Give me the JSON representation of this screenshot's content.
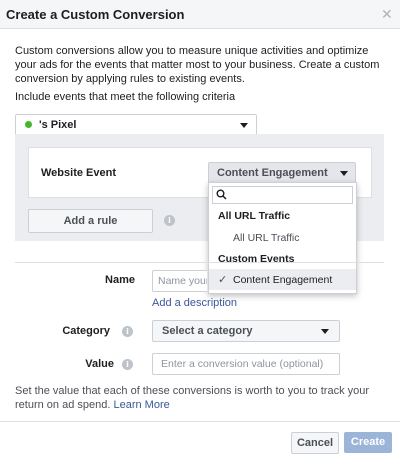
{
  "dialog": {
    "title": "Create a Custom Conversion",
    "close_icon": "close-icon"
  },
  "intro": {
    "text": "Custom conversions allow you to measure unique activities and optimize your ads for the events that matter most to your business. Create a custom conversion by applying rules to existing events.",
    "criteria_label": "Include events that meet the following criteria"
  },
  "pixel": {
    "label": "'s Pixel",
    "status_color": "#42b72a"
  },
  "rule": {
    "event_label": "Website Event",
    "event_selected": "Content Engagement",
    "add_rule_label": "Add a rule"
  },
  "event_menu": {
    "search_icon": "search-icon",
    "group1_header": "All URL Traffic",
    "group1_item": "All URL Traffic",
    "group2_header": "Custom Events",
    "group2_item": "Content Engagement",
    "checked_icon": "check-icon"
  },
  "form": {
    "name_label": "Name",
    "name_placeholder": "Name your c",
    "add_description": "Add a description",
    "category_label": "Category",
    "category_value": "Select a category",
    "value_label": "Value",
    "value_placeholder": "Enter a conversion value (optional)"
  },
  "helper": {
    "text": "Set the value that each of these conversions is worth to you to track your return on ad spend.",
    "learn_more": "Learn More"
  },
  "footer": {
    "cancel_label": "Cancel",
    "create_label": "Create"
  },
  "colors": {
    "primary_disabled": "#9cb4d8",
    "link": "#385898",
    "selected_row": "#ebedf0"
  }
}
